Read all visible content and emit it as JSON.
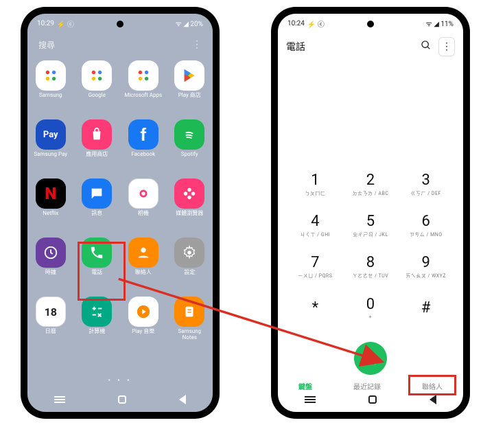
{
  "page": {
    "arrow_color": "#d93025"
  },
  "left_phone": {
    "statusbar": {
      "time": "10:29",
      "left_extra": "⚡ ⓒ",
      "right": "ᯤ ◢ 20%"
    },
    "search_placeholder": "搜尋",
    "apps": [
      {
        "icon": "folder",
        "label": "Samsung",
        "bg": "bg-white"
      },
      {
        "icon": "folder",
        "label": "Google",
        "bg": "bg-white"
      },
      {
        "icon": "folder",
        "label": "Microsoft Apps",
        "bg": "bg-white"
      },
      {
        "icon": "play",
        "label": "Play 商店",
        "bg": "bg-white"
      },
      {
        "icon": "pay",
        "label": "Samsung Pay",
        "bg": "bg-pay"
      },
      {
        "icon": "bag",
        "label": "應用商店",
        "bg": "bg-pink"
      },
      {
        "icon": "fb",
        "label": "Facebook",
        "bg": "bg-blue"
      },
      {
        "icon": "spotify",
        "label": "Spotify",
        "bg": "bg-green"
      },
      {
        "icon": "N",
        "label": "Netflix",
        "bg": "bg-red"
      },
      {
        "icon": "msg",
        "label": "訊息",
        "bg": "bg-blue"
      },
      {
        "icon": "cam",
        "label": "相機",
        "bg": "bg-white-border"
      },
      {
        "icon": "flower",
        "label": "媒體瀏覽器",
        "bg": "bg-pink"
      },
      {
        "icon": "clock",
        "label": "時鐘",
        "bg": "bg-purple"
      },
      {
        "icon": "phone",
        "label": "電話",
        "bg": "bg-call"
      },
      {
        "icon": "person",
        "label": "聯絡人",
        "bg": "bg-orange"
      },
      {
        "icon": "gear",
        "label": "設定",
        "bg": "bg-grey"
      },
      {
        "icon": "18",
        "label": "日曆",
        "bg": "bg-white-border"
      },
      {
        "icon": "calc",
        "label": "計算機",
        "bg": "bg-teal"
      },
      {
        "icon": "playmusic",
        "label": "Play 音樂",
        "bg": "bg-white"
      },
      {
        "icon": "notes",
        "label": "Samsung Notes",
        "bg": "bg-orange"
      }
    ],
    "highlight_app_index": 13
  },
  "right_phone": {
    "statusbar": {
      "time": "10:24",
      "left_extra": "⚡ ⓒ",
      "right": "ᯤ ◢ 11%"
    },
    "header_title": "電話",
    "keys": [
      {
        "d": "1",
        "s": "ㄅㄆㄇㄈ"
      },
      {
        "d": "2",
        "s": "ㄉㄊㄋㄌ / ABC"
      },
      {
        "d": "3",
        "s": "ㄍㄎㄏ / DEF"
      },
      {
        "d": "4",
        "s": "ㄐㄑㄒ / GHI"
      },
      {
        "d": "5",
        "s": "ㄓㄔㄕㄖ / JKL"
      },
      {
        "d": "6",
        "s": "ㄗㄘㄙ / MNO"
      },
      {
        "d": "7",
        "s": "ㄧㄨㄩ / PQRS"
      },
      {
        "d": "8",
        "s": "ㄚㄛㄜㄝ / TUV"
      },
      {
        "d": "9",
        "s": "ㄞㄟㄠㄡ / WXYZ"
      },
      {
        "d": "*",
        "s": ""
      },
      {
        "d": "0",
        "s": "+"
      },
      {
        "d": "#",
        "s": ""
      }
    ],
    "tabs": [
      {
        "label": "鍵盤",
        "active": true
      },
      {
        "label": "最近記錄",
        "active": false
      },
      {
        "label": "聯絡人",
        "active": false
      }
    ],
    "highlight_tab_index": 2
  }
}
